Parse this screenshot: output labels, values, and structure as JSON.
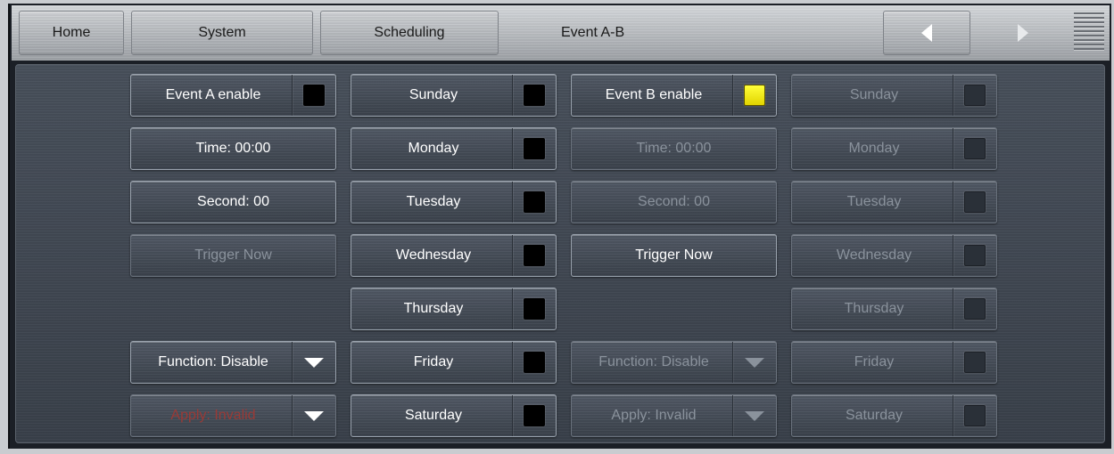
{
  "nav": {
    "home": "Home",
    "system": "System",
    "scheduling": "Scheduling",
    "title": "Event A-B",
    "prev_icon": "triangle-left-icon",
    "next_icon": "triangle-right-icon",
    "menu_icon": "hamburger-menu-icon"
  },
  "eventA": {
    "enable": {
      "label": "Event A enable",
      "state": "off"
    },
    "time": "Time: 00:00",
    "second": "Second: 00",
    "trigger": "Trigger Now",
    "function": "Function: Disable",
    "apply": "Apply: Invalid",
    "days": [
      {
        "label": "Sunday",
        "state": "off"
      },
      {
        "label": "Monday",
        "state": "off"
      },
      {
        "label": "Tuesday",
        "state": "off"
      },
      {
        "label": "Wednesday",
        "state": "off"
      },
      {
        "label": "Thursday",
        "state": "off"
      },
      {
        "label": "Friday",
        "state": "off"
      },
      {
        "label": "Saturday",
        "state": "off"
      }
    ]
  },
  "eventB": {
    "enable": {
      "label": "Event B enable",
      "state": "on"
    },
    "time": "Time: 00:00",
    "second": "Second: 00",
    "trigger": "Trigger Now",
    "function": "Function: Disable",
    "apply": "Apply: Invalid",
    "days": [
      {
        "label": "Sunday",
        "state": "off"
      },
      {
        "label": "Monday",
        "state": "off"
      },
      {
        "label": "Tuesday",
        "state": "off"
      },
      {
        "label": "Wednesday",
        "state": "off"
      },
      {
        "label": "Thursday",
        "state": "off"
      },
      {
        "label": "Friday",
        "state": "off"
      },
      {
        "label": "Saturday",
        "state": "off"
      }
    ]
  },
  "colors": {
    "led_on": "#f2e800",
    "led_off": "#000000",
    "apply_invalid_text": "#9a3a36"
  }
}
